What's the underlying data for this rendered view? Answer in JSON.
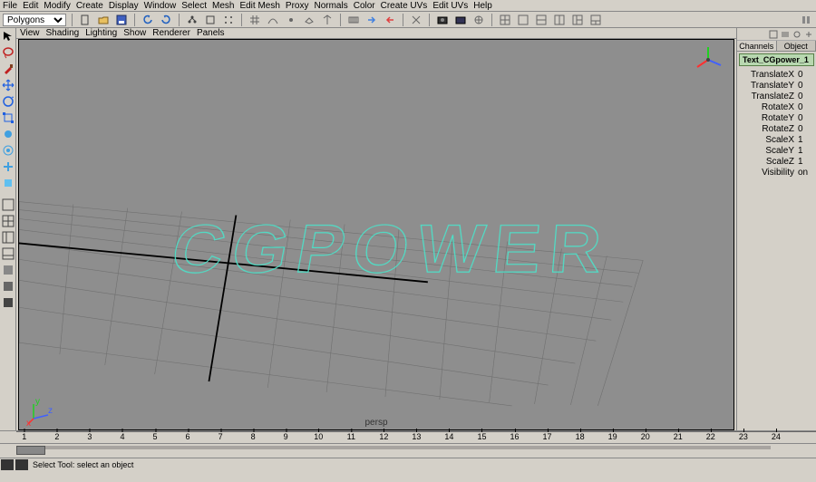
{
  "menus": [
    "File",
    "Edit",
    "Modify",
    "Create",
    "Display",
    "Window",
    "Select",
    "Mesh",
    "Edit Mesh",
    "Proxy",
    "Normals",
    "Color",
    "Create UVs",
    "Edit UVs",
    "Help"
  ],
  "status": {
    "dropdown": "Polygons"
  },
  "view_menus": [
    "View",
    "Shading",
    "Lighting",
    "Show",
    "Renderer",
    "Panels"
  ],
  "viewport": {
    "label": "persp",
    "text3d": "CGPOWER"
  },
  "right": {
    "tabs": [
      "Channels",
      "Object"
    ],
    "node": "Text_CGpower_1",
    "attrs": [
      {
        "l": "TranslateX",
        "v": "0"
      },
      {
        "l": "TranslateY",
        "v": "0"
      },
      {
        "l": "TranslateZ",
        "v": "0"
      },
      {
        "l": "RotateX",
        "v": "0"
      },
      {
        "l": "RotateY",
        "v": "0"
      },
      {
        "l": "RotateZ",
        "v": "0"
      },
      {
        "l": "ScaleX",
        "v": "1"
      },
      {
        "l": "ScaleY",
        "v": "1"
      },
      {
        "l": "ScaleZ",
        "v": "1"
      },
      {
        "l": "Visibility",
        "v": "on"
      }
    ]
  },
  "timeline": {
    "ticks": [
      "1",
      "2",
      "3",
      "4",
      "5",
      "6",
      "7",
      "8",
      "9",
      "10",
      "11",
      "12",
      "13",
      "14",
      "15",
      "16",
      "17",
      "18",
      "19",
      "20",
      "21",
      "22",
      "23",
      "24"
    ]
  },
  "statusbar": {
    "text": "Select Tool: select an object"
  }
}
